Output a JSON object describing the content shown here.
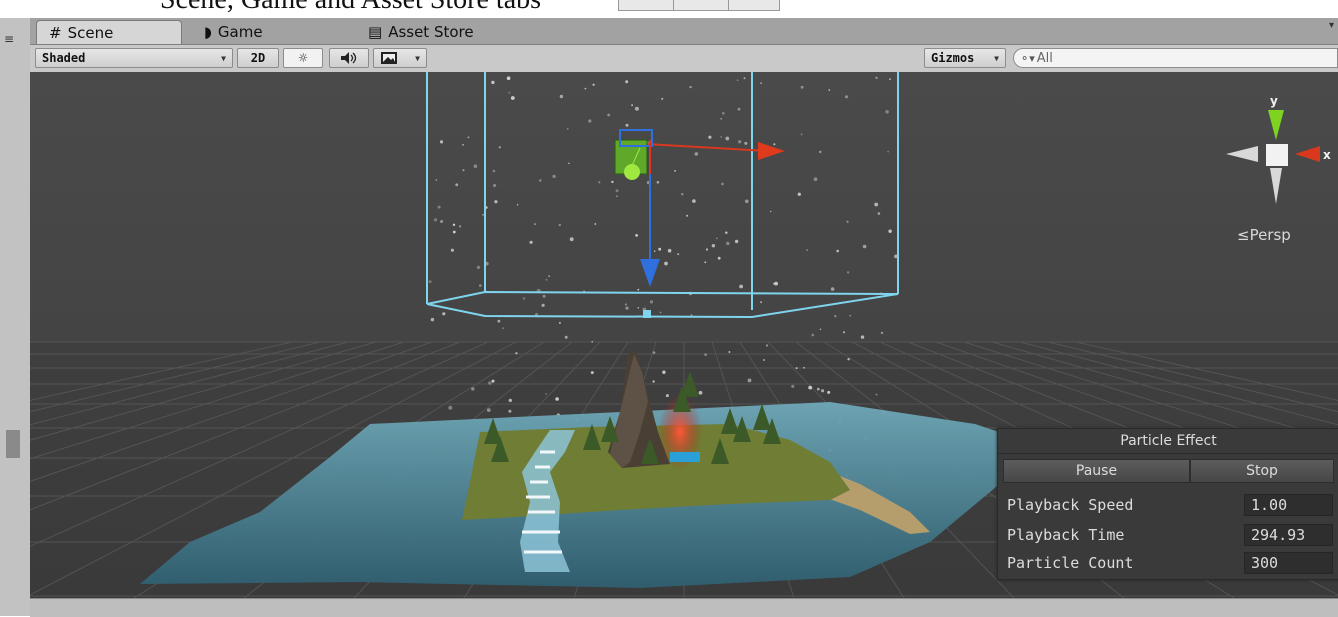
{
  "page_text_fragment": "Scene, Game and Asset Store tabs",
  "tabs": [
    {
      "icon": "#",
      "label": "Scene"
    },
    {
      "icon": "◗",
      "label": "Game"
    },
    {
      "icon": "▤",
      "label": "Asset Store"
    }
  ],
  "toolbar": {
    "draw_mode": "Shaded",
    "mode_2d": "2D",
    "gizmos": "Gizmos",
    "search_placeholder": "All"
  },
  "gizmo": {
    "x_label": "x",
    "y_label": "y",
    "projection": "≤Persp"
  },
  "particle_panel": {
    "title": "Particle Effect",
    "pause_label": "Pause",
    "stop_label": "Stop",
    "rows": [
      {
        "label": "Playback Speed",
        "value": "1.00"
      },
      {
        "label": "Playback Time",
        "value": "294.93"
      },
      {
        "label": "Particle Count",
        "value": "300"
      }
    ]
  },
  "colors": {
    "viewport_bg": "#494949",
    "bounds_box": "#7fd4ee",
    "axis_x": "#d9381e",
    "axis_y": "#7ed321",
    "axis_z": "#2f6fde",
    "water": "#4d8ea0",
    "grass": "#6f7d35"
  },
  "icons": [
    "scene-hash-icon",
    "game-pacman-icon",
    "asset-store-icon",
    "sun-lighting-icon",
    "speaker-audio-icon",
    "image-effects-icon",
    "search-icon"
  ]
}
